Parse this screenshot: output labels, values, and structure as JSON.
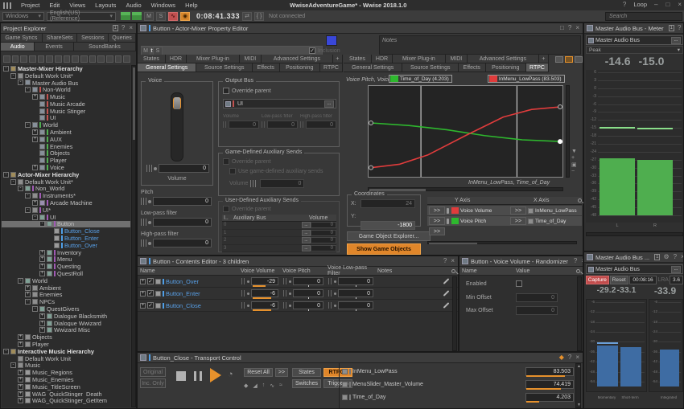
{
  "titlebar": {
    "menus": [
      "Project",
      "Edit",
      "Views",
      "Layouts",
      "Audio",
      "Windows",
      "Help"
    ],
    "title": "WwiseAdventureGame* - Wwise 2018.1.0",
    "help_icon": "?",
    "loop_label": "Loop",
    "minimize": "–",
    "maximize": "□",
    "close": "×"
  },
  "toolbar": {
    "platform": "Windows",
    "language": "English(US) (Reference)",
    "mute": "M",
    "solo": "S",
    "profiler_icon": "∿",
    "capture_icon": "◉",
    "time": "0:08:41.333",
    "remote_icon": "⇄",
    "braces_icon": "{ }",
    "connection": "Not connected",
    "search_placeholder": "Search"
  },
  "project_explorer": {
    "title": "Project Explorer",
    "badge": "1",
    "help": "?",
    "close": "×",
    "tabs_top": [
      "Game Syncs",
      "ShareSets",
      "Sessions",
      "Queries"
    ],
    "tabs_bottom": [
      "Audio",
      "Events",
      "SoundBanks"
    ],
    "active_tab": "Audio",
    "toolbar_icon_count": 15,
    "tree": [
      {
        "label": "Master-Mixer Hierarchy",
        "lvl": 0,
        "exp": "-",
        "icon": "folder",
        "bold": true
      },
      {
        "label": "Default Work Unit*",
        "lvl": 1,
        "exp": "-",
        "icon": "wu"
      },
      {
        "label": "Master Audio Bus",
        "lvl": 2,
        "exp": "-",
        "icon": "bus"
      },
      {
        "label": "Non-World",
        "lvl": 3,
        "exp": "-",
        "icon": "bus",
        "bar": "red"
      },
      {
        "label": "Music",
        "lvl": 4,
        "exp": "+",
        "icon": "bus",
        "bar": "red"
      },
      {
        "label": "Music Arcade",
        "lvl": 4,
        "icon": "bus",
        "bar": "red"
      },
      {
        "label": "Music Stinger",
        "lvl": 4,
        "icon": "bus",
        "bar": "red"
      },
      {
        "label": "UI",
        "lvl": 4,
        "icon": "bus",
        "bar": "red"
      },
      {
        "label": "World",
        "lvl": 3,
        "exp": "-",
        "icon": "bus",
        "bar": "green"
      },
      {
        "label": "Ambient",
        "lvl": 4,
        "exp": "+",
        "icon": "bus",
        "bar": "green"
      },
      {
        "label": "AUX",
        "lvl": 4,
        "exp": "+",
        "icon": "bus",
        "bar": "green"
      },
      {
        "label": "Enemies",
        "lvl": 4,
        "icon": "bus",
        "bar": "green"
      },
      {
        "label": "Objects",
        "lvl": 4,
        "icon": "bus",
        "bar": "green"
      },
      {
        "label": "Player",
        "lvl": 4,
        "icon": "bus",
        "bar": "green"
      },
      {
        "label": "Voice",
        "lvl": 4,
        "exp": "+",
        "icon": "bus",
        "bar": "green"
      },
      {
        "label": "Actor-Mixer Hierarchy",
        "lvl": 0,
        "exp": "-",
        "icon": "folder",
        "bold": true
      },
      {
        "label": "Default Work Unit*",
        "lvl": 1,
        "exp": "-",
        "icon": "wu"
      },
      {
        "label": "Non_World",
        "lvl": 2,
        "exp": "-",
        "icon": "am",
        "bar": "purple"
      },
      {
        "label": "Instruments*",
        "lvl": 3,
        "exp": "-",
        "icon": "wu",
        "bar": "purple"
      },
      {
        "label": "Arcade Machine",
        "lvl": 4,
        "exp": "+",
        "icon": "blend",
        "bar": "purple"
      },
      {
        "label": "UI*",
        "lvl": 3,
        "exp": "-",
        "icon": "wu",
        "bar": "purple"
      },
      {
        "label": "UI",
        "lvl": 4,
        "exp": "-",
        "icon": "am",
        "bar": "purple"
      },
      {
        "label": "Button",
        "lvl": 5,
        "exp": "-",
        "icon": "am",
        "bar": "purple",
        "sel": true
      },
      {
        "label": "Button_Close",
        "lvl": 6,
        "icon": "snd",
        "bar": "blue",
        "blue": true
      },
      {
        "label": "Button_Enter",
        "lvl": 6,
        "icon": "snd",
        "bar": "blue",
        "blue": true
      },
      {
        "label": "Button_Over",
        "lvl": 6,
        "icon": "snd",
        "bar": "blue",
        "blue": true
      },
      {
        "label": "Inventory",
        "lvl": 5,
        "exp": "+",
        "icon": "am",
        "bar": "purple"
      },
      {
        "label": "Menu",
        "lvl": 5,
        "exp": "+",
        "icon": "am",
        "bar": "purple"
      },
      {
        "label": "Questing",
        "lvl": 5,
        "exp": "+",
        "icon": "am",
        "bar": "purple"
      },
      {
        "label": "QuestRoll",
        "lvl": 5,
        "exp": "+",
        "icon": "am",
        "bar": "purple"
      },
      {
        "label": "World",
        "lvl": 2,
        "exp": "-",
        "icon": "am"
      },
      {
        "label": "Ambient",
        "lvl": 3,
        "exp": "+",
        "icon": "wu"
      },
      {
        "label": "Enemies",
        "lvl": 3,
        "exp": "+",
        "icon": "wu"
      },
      {
        "label": "NPCs",
        "lvl": 3,
        "exp": "-",
        "icon": "wu"
      },
      {
        "label": "QuestGivers",
        "lvl": 4,
        "exp": "-",
        "icon": "am"
      },
      {
        "label": "Dialogue Blacksmith",
        "lvl": 5,
        "exp": "+",
        "icon": "am"
      },
      {
        "label": "Dialogue Wwizard",
        "lvl": 5,
        "exp": "+",
        "icon": "am"
      },
      {
        "label": "Wwizard Misc",
        "lvl": 5,
        "exp": "+",
        "icon": "am"
      },
      {
        "label": "Objects",
        "lvl": 2,
        "exp": "+",
        "icon": "wu"
      },
      {
        "label": "Player",
        "lvl": 2,
        "exp": "+",
        "icon": "wu"
      },
      {
        "label": "Interactive Music Hierarchy",
        "lvl": 0,
        "exp": "-",
        "icon": "folder",
        "bold": true
      },
      {
        "label": "Default Work Unit",
        "lvl": 1,
        "icon": "wu"
      },
      {
        "label": "Music",
        "lvl": 1,
        "exp": "-",
        "icon": "wu"
      },
      {
        "label": "Music_Regions",
        "lvl": 2,
        "exp": "+",
        "icon": "music"
      },
      {
        "label": "Music_Enemies",
        "lvl": 2,
        "exp": "+",
        "icon": "music"
      },
      {
        "label": "Music_TitleScreen",
        "lvl": 2,
        "exp": "+",
        "icon": "music"
      },
      {
        "label": "WAG_QuickStinger_Death",
        "lvl": 2,
        "exp": "+",
        "icon": "music"
      },
      {
        "label": "WAG_QuickStinger_GetItem",
        "lvl": 2,
        "exp": "+",
        "icon": "music"
      }
    ]
  },
  "property_editor": {
    "title": "Button - Actor-Mixer Property Editor",
    "name": "Button",
    "notes_label": "Notes",
    "mute": "M",
    "solo": "S",
    "inclusion": "Inclusion",
    "tabs_top": [
      "States",
      "HDR",
      "Mixer Plug-in",
      "MIDI",
      "Advanced Settings",
      "+"
    ],
    "tabs_bottom": [
      "General Settings",
      "Source Settings",
      "Effects",
      "Positioning",
      "RTPC"
    ],
    "left_active": "General Settings",
    "right_active": "RTPC",
    "voice": {
      "title": "Voice",
      "volume_label": "Volume",
      "volume": "0",
      "pitch_label": "Pitch",
      "pitch": "0",
      "lpf_label": "Low-pass filter",
      "lpf": "0",
      "hpf_label": "High-pass filter",
      "hpf": "0"
    },
    "output_bus": {
      "title": "Output Bus",
      "override": "Override parent",
      "bus": "UI",
      "browse": "...",
      "cols": [
        "Volume",
        "Low-pass filter",
        "High-pass filter"
      ],
      "values": [
        "0",
        "0",
        "0"
      ]
    },
    "gdas": {
      "title": "Game-Defined Auxiliary Sends",
      "override": "Override parent",
      "use": "Use game-defined auxiliary sends",
      "volume_label": "Volume",
      "volume": "0"
    },
    "udas": {
      "title": "User-Defined Auxiliary Sends",
      "override": "Override parent",
      "cols": [
        "I..",
        "Auxiliary Bus",
        "Volume"
      ],
      "rows": [
        {
          "id": "0",
          "vol": "0"
        },
        {
          "id": "1",
          "vol": "0"
        },
        {
          "id": "2",
          "vol": "0"
        },
        {
          "id": "3",
          "vol": "0"
        }
      ]
    }
  },
  "rtpc": {
    "y_label": "Voice Pitch, Voice Volume",
    "x_label": "InMenu_LowPass, Time_of_Day",
    "legend": [
      {
        "name": "Time_of_Day (4.203)",
        "color": "#2eb82e"
      },
      {
        "name": "InMenu_LowPass (83.503)",
        "color": "#e03c3c"
      }
    ],
    "graph": {
      "cursors": [
        0.27,
        0.765
      ],
      "curves": [
        {
          "color": "#2eb82e",
          "sel_end": true,
          "pts": [
            [
              0,
              0.4
            ],
            [
              0.2,
              0.43
            ],
            [
              0.4,
              0.48
            ],
            [
              0.6,
              0.55
            ],
            [
              0.8,
              0.6
            ],
            [
              1,
              0.62
            ]
          ]
        },
        {
          "color": "#e03c3c",
          "sel_end": false,
          "pts": [
            [
              0,
              0.93
            ],
            [
              0.15,
              0.89
            ],
            [
              0.3,
              0.78
            ],
            [
              0.5,
              0.55
            ],
            [
              0.7,
              0.33
            ],
            [
              0.85,
              0.24
            ],
            [
              1,
              0.21
            ]
          ]
        }
      ]
    },
    "coordinates": {
      "title": "Coordinates",
      "x_label": "X:",
      "x": "24",
      "y_label": "Y:",
      "y": "-1800"
    },
    "buttons": {
      "explorer": "Game Object Explorer...",
      "show": "Show Game Objects"
    },
    "table": {
      "y_axis": "Y Axis",
      "x_axis": "X Axis",
      "chev": ">>",
      "rows": [
        {
          "y": "Voice Volume",
          "ycolor": "#e03c3c",
          "x": "InMenu_LowPass"
        },
        {
          "y": "Voice Pitch",
          "ycolor": "#2eb82e",
          "x": "Time_of_Day"
        }
      ]
    }
  },
  "contents_editor": {
    "title": "Button - Contents Editor - 3 children",
    "help": "?",
    "close": "×",
    "columns": [
      "Name",
      "Voice Volume",
      "Voice Pitch",
      "Voice Low-pass Filter",
      "Notes"
    ],
    "rows": [
      {
        "name": "Button_Over",
        "volume": "-29",
        "vol_pct": 50,
        "pitch": "0",
        "lpf": "0"
      },
      {
        "name": "Button_Enter",
        "volume": "-6",
        "vol_pct": 72,
        "pitch": "0",
        "lpf": "0"
      },
      {
        "name": "Button_Close",
        "volume": "-6",
        "vol_pct": 72,
        "pitch": "0",
        "lpf": "0"
      }
    ]
  },
  "randomizer": {
    "title": "Button - Voice Volume - Randomizer",
    "help": "?",
    "close": "×",
    "cols": [
      "Name",
      "Value"
    ],
    "enabled_label": "Enabled",
    "min_label": "Min Offset",
    "min": "0",
    "max_label": "Max Offset",
    "max": "0"
  },
  "transport": {
    "title": "Button_Close - Transport Control",
    "original": "Original",
    "inc_only": "Inc. Only",
    "reset_all": "Reset All",
    "more": ">>",
    "filters": [
      "States",
      "RTPCs",
      "Switches",
      "Triggers"
    ],
    "active_filter": "RTPCs",
    "rtpcs": [
      {
        "name": "InMenu_LowPass",
        "value": "83.503",
        "pct": 83
      },
      {
        "name": "MenuSlider_Master_Volume",
        "value": "74.419",
        "pct": 74
      },
      {
        "name": "Time_of_Day",
        "value": "4.203",
        "pct": 27
      }
    ]
  },
  "meter": {
    "title": "Master Audio Bus - Meter",
    "badge": "1",
    "help": "?",
    "close": "×",
    "bus": "Master Audio Bus",
    "browse": "...",
    "mode": "Peak",
    "values": [
      "-14.6",
      "-15.0"
    ],
    "scale_max": 6,
    "scale_min": -48,
    "step": 3,
    "bar_color": "#4fae4f",
    "peak_color": "#8ade8a",
    "channels": [
      {
        "label": "L",
        "bar": -26.5,
        "peak": -14.6
      },
      {
        "label": "R",
        "bar": -27.2,
        "peak": -15.0
      }
    ]
  },
  "loudness": {
    "title": "Master Audio Bus ...",
    "badge": "1",
    "gear": "⚙",
    "help": "?",
    "close": "×",
    "bus": "Master Audio Bus",
    "browse": "...",
    "capture": "Capture",
    "reset": "Reset",
    "time": "00:08:16",
    "lra_label": "LRA",
    "lra": "3.6",
    "scale_max": -6,
    "scale_min": -57,
    "step": 6,
    "bar_color": "#3e6ca3",
    "peak_color": "#6b9fd8",
    "panes": [
      {
        "values": [
          "-29.2",
          "-33.1"
        ],
        "bars": [
          {
            "label": "Momentary",
            "bar": -32.2,
            "peak": -30.3
          },
          {
            "label": "Short-term",
            "bar": -33.4
          }
        ]
      },
      {
        "values": [
          "-33.9"
        ],
        "bars": [
          {
            "label": "Integrated",
            "bar": -34.6
          }
        ]
      }
    ]
  }
}
